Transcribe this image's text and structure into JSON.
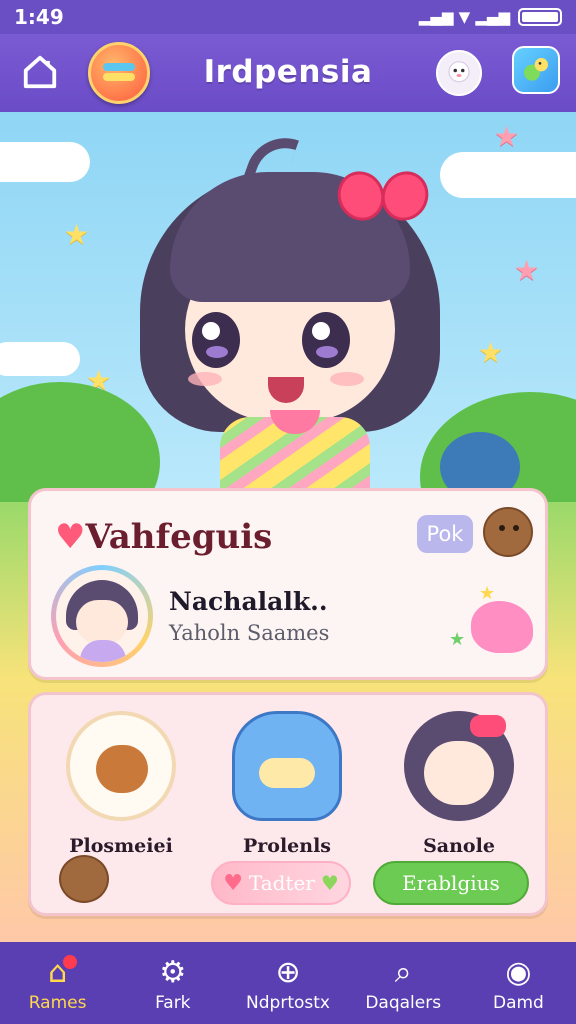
{
  "status_bar": {
    "time": "1:49",
    "signal_text": "▂▄▆ ▼ ▂▄▆"
  },
  "header": {
    "title": "Irdpensia",
    "home_icon": "home-icon",
    "logo_icon": "app-logo-icon",
    "ghost_icon": "ghost-avatar-icon",
    "game_icon": "game-icon"
  },
  "profile_card": {
    "title": "Vahfeguis",
    "badge": "Pok",
    "name": "Nachalalk..",
    "subtitle": "Yaholn Saames"
  },
  "friends": [
    {
      "label": "Plosmeiei"
    },
    {
      "label": "Prolenls"
    },
    {
      "label": "Sanole"
    }
  ],
  "actions": {
    "later_label": "Tadter",
    "enable_label": "Erablgius"
  },
  "nav": [
    {
      "label": "Rames",
      "icon": "home-icon",
      "active": true
    },
    {
      "label": "Fark",
      "icon": "gear-icon"
    },
    {
      "label": "Ndprtostx",
      "icon": "add-icon"
    },
    {
      "label": "Daqalers",
      "icon": "search-icon"
    },
    {
      "label": "Damd",
      "icon": "profile-icon"
    }
  ],
  "colors": {
    "accent": "#6a4fc4",
    "nav_bg": "#5a3fb2",
    "enable_green": "#6ccb52",
    "card_border": "#f4c4cd"
  }
}
